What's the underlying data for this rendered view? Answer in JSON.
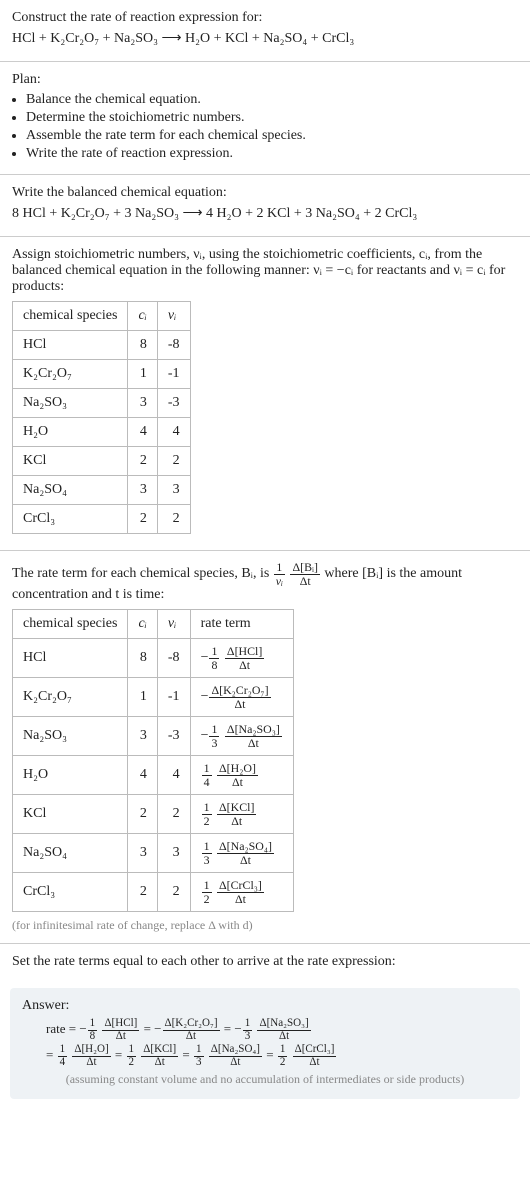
{
  "intro": {
    "prompt": "Construct the rate of reaction expression for:",
    "equation": "HCl + K₂Cr₂O₇ + Na₂SO₃  ⟶  H₂O + KCl + Na₂SO₄ + CrCl₃"
  },
  "plan": {
    "heading": "Plan:",
    "items": [
      "Balance the chemical equation.",
      "Determine the stoichiometric numbers.",
      "Assemble the rate term for each chemical species.",
      "Write the rate of reaction expression."
    ]
  },
  "balanced": {
    "heading": "Write the balanced chemical equation:",
    "equation": "8 HCl + K₂Cr₂O₇ + 3 Na₂SO₃  ⟶  4 H₂O + 2 KCl + 3 Na₂SO₄ + 2 CrCl₃"
  },
  "stoich": {
    "intro": "Assign stoichiometric numbers, νᵢ, using the stoichiometric coefficients, cᵢ, from the balanced chemical equation in the following manner: νᵢ = −cᵢ for reactants and νᵢ = cᵢ for products:",
    "headers": {
      "species": "chemical species",
      "c": "cᵢ",
      "v": "νᵢ"
    },
    "rows": [
      {
        "species": "HCl",
        "c": "8",
        "v": "-8"
      },
      {
        "species": "K₂Cr₂O₇",
        "c": "1",
        "v": "-1"
      },
      {
        "species": "Na₂SO₃",
        "c": "3",
        "v": "-3"
      },
      {
        "species": "H₂O",
        "c": "4",
        "v": "4"
      },
      {
        "species": "KCl",
        "c": "2",
        "v": "2"
      },
      {
        "species": "Na₂SO₄",
        "c": "3",
        "v": "3"
      },
      {
        "species": "CrCl₃",
        "c": "2",
        "v": "2"
      }
    ]
  },
  "rateterm": {
    "intro1": "The rate term for each chemical species, Bᵢ, is ",
    "intro_frac_outer_num": "1",
    "intro_frac_outer_den": "νᵢ",
    "intro_frac_inner_num": "Δ[Bᵢ]",
    "intro_frac_inner_den": "Δt",
    "intro2": " where [Bᵢ] is the amount concentration and t is time:",
    "headers": {
      "species": "chemical species",
      "c": "cᵢ",
      "v": "νᵢ",
      "rate": "rate term"
    },
    "rows": [
      {
        "species": "HCl",
        "c": "8",
        "v": "-8",
        "sign": "−",
        "coef_num": "1",
        "coef_den": "8",
        "dnum": "Δ[HCl]",
        "dden": "Δt"
      },
      {
        "species": "K₂Cr₂O₇",
        "c": "1",
        "v": "-1",
        "sign": "−",
        "coef_num": "",
        "coef_den": "",
        "dnum": "Δ[K₂Cr₂O₇]",
        "dden": "Δt"
      },
      {
        "species": "Na₂SO₃",
        "c": "3",
        "v": "-3",
        "sign": "−",
        "coef_num": "1",
        "coef_den": "3",
        "dnum": "Δ[Na₂SO₃]",
        "dden": "Δt"
      },
      {
        "species": "H₂O",
        "c": "4",
        "v": "4",
        "sign": "",
        "coef_num": "1",
        "coef_den": "4",
        "dnum": "Δ[H₂O]",
        "dden": "Δt"
      },
      {
        "species": "KCl",
        "c": "2",
        "v": "2",
        "sign": "",
        "coef_num": "1",
        "coef_den": "2",
        "dnum": "Δ[KCl]",
        "dden": "Δt"
      },
      {
        "species": "Na₂SO₄",
        "c": "3",
        "v": "3",
        "sign": "",
        "coef_num": "1",
        "coef_den": "3",
        "dnum": "Δ[Na₂SO₄]",
        "dden": "Δt"
      },
      {
        "species": "CrCl₃",
        "c": "2",
        "v": "2",
        "sign": "",
        "coef_num": "1",
        "coef_den": "2",
        "dnum": "Δ[CrCl₃]",
        "dden": "Δt"
      }
    ],
    "note": "(for infinitesimal rate of change, replace Δ with d)"
  },
  "final": {
    "heading": "Set the rate terms equal to each other to arrive at the rate expression:"
  },
  "answer": {
    "label": "Answer:",
    "prefix": "rate = ",
    "terms_line1": [
      {
        "sign": "−",
        "coef_num": "1",
        "coef_den": "8",
        "dnum": "Δ[HCl]",
        "dden": "Δt"
      },
      {
        "sign": "−",
        "coef_num": "",
        "coef_den": "",
        "dnum": "Δ[K₂Cr₂O₇]",
        "dden": "Δt"
      },
      {
        "sign": "−",
        "coef_num": "1",
        "coef_den": "3",
        "dnum": "Δ[Na₂SO₃]",
        "dden": "Δt"
      }
    ],
    "terms_line2": [
      {
        "sign": "",
        "coef_num": "1",
        "coef_den": "4",
        "dnum": "Δ[H₂O]",
        "dden": "Δt"
      },
      {
        "sign": "",
        "coef_num": "1",
        "coef_den": "2",
        "dnum": "Δ[KCl]",
        "dden": "Δt"
      },
      {
        "sign": "",
        "coef_num": "1",
        "coef_den": "3",
        "dnum": "Δ[Na₂SO₄]",
        "dden": "Δt"
      },
      {
        "sign": "",
        "coef_num": "1",
        "coef_den": "2",
        "dnum": "Δ[CrCl₃]",
        "dden": "Δt"
      }
    ],
    "note": "(assuming constant volume and no accumulation of intermediates or side products)"
  },
  "chart_data": {
    "type": "table",
    "title": "Stoichiometric coefficients and numbers",
    "columns": [
      "chemical species",
      "cᵢ",
      "νᵢ"
    ],
    "rows": [
      [
        "HCl",
        8,
        -8
      ],
      [
        "K₂Cr₂O₇",
        1,
        -1
      ],
      [
        "Na₂SO₃",
        3,
        -3
      ],
      [
        "H₂O",
        4,
        4
      ],
      [
        "KCl",
        2,
        2
      ],
      [
        "Na₂SO₄",
        3,
        3
      ],
      [
        "CrCl₃",
        2,
        2
      ]
    ]
  }
}
